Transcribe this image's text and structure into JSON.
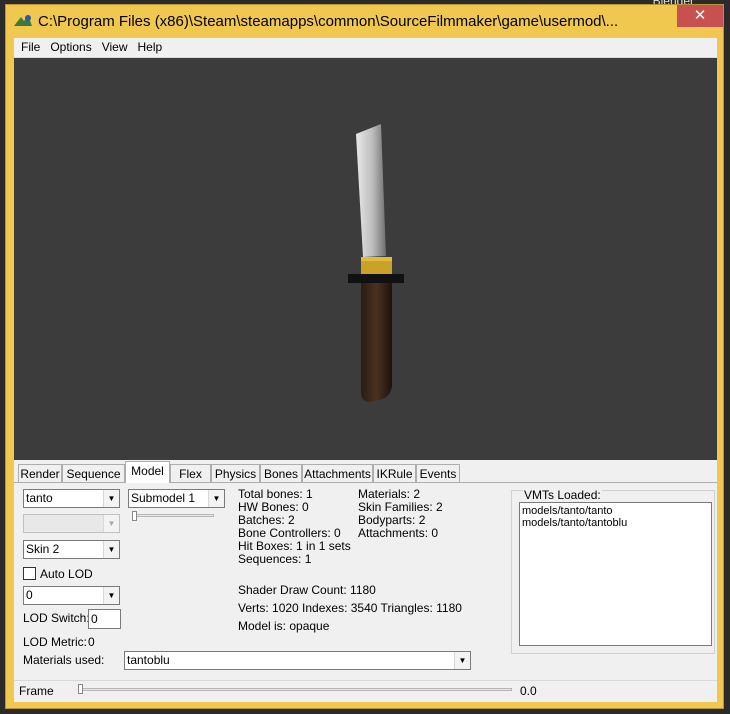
{
  "background_label": "Blender",
  "window": {
    "title": "C:\\Program Files (x86)\\Steam\\steamapps\\common\\SourceFilmmaker\\game\\usermod\\...",
    "close_glyph": "✕"
  },
  "menu": [
    "File",
    "Options",
    "View",
    "Help"
  ],
  "tabs": [
    "Render",
    "Sequence",
    "Model",
    "Flex",
    "Physics",
    "Bones",
    "Attachments",
    "IKRule",
    "Events"
  ],
  "active_tab": "Model",
  "model": {
    "model_select": "tanto",
    "submodel_select": "Submodel 1",
    "skin_select": "Skin 2",
    "auto_lod_label": "Auto LOD",
    "lod_select": "0",
    "lod_switch_label": "LOD Switch:",
    "lod_switch_value": "0",
    "lod_metric_label": "LOD Metric:",
    "lod_metric_value": "0",
    "materials_used_label": "Materials used:",
    "materials_used_value": "tantoblu"
  },
  "stats_left": [
    "Total bones: 1",
    "HW Bones: 0",
    "Batches: 2",
    "Bone Controllers: 0",
    "Hit Boxes: 1 in 1 sets",
    "Sequences: 1"
  ],
  "stats_right": [
    "Materials: 2",
    "Skin Families: 2",
    "Bodyparts: 2",
    "Attachments: 0"
  ],
  "shader_draw_count": "Shader Draw Count: 1180",
  "geometry": "Verts: 1020  Indexes: 3540  Triangles: 1180",
  "model_is": "Model is: opaque",
  "vmts": {
    "label": "VMTs Loaded:",
    "items": [
      "models/tanto/tanto",
      "models/tanto/tantoblu"
    ]
  },
  "frame": {
    "label": "Frame",
    "value": "0.0"
  },
  "colors": {
    "title_bar": "#f0c850",
    "viewport": "#3c3c3c",
    "close_button": "#c75050"
  }
}
